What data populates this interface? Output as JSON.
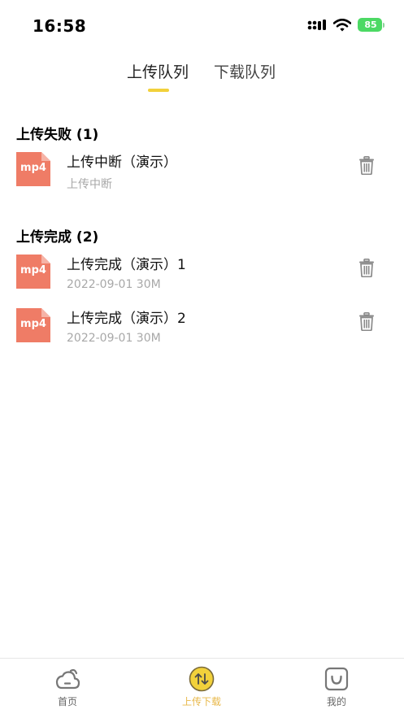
{
  "status_bar": {
    "time": "16:58",
    "battery": "85"
  },
  "tabs": [
    {
      "label": "上传队列",
      "active": true
    },
    {
      "label": "下载队列",
      "active": false
    }
  ],
  "sections": {
    "failed": {
      "title": "上传失败 (1)",
      "items": [
        {
          "ext": "mp4",
          "name": "上传中断（演示）",
          "meta": "上传中断"
        }
      ]
    },
    "done": {
      "title": "上传完成 (2)",
      "items": [
        {
          "ext": "mp4",
          "name": "上传完成（演示）1",
          "meta": "2022-09-01 30M"
        },
        {
          "ext": "mp4",
          "name": "上传完成（演示）2",
          "meta": "2022-09-01 30M"
        }
      ]
    }
  },
  "bottom_nav": [
    {
      "label": "首页",
      "icon": "cloud-icon",
      "active": false
    },
    {
      "label": "上传下载",
      "icon": "transfer-icon",
      "active": true
    },
    {
      "label": "我的",
      "icon": "face-icon",
      "active": false
    }
  ],
  "colors": {
    "accent": "#f2d13b",
    "active_label": "#e8b84a",
    "file_icon": "#ef7c66",
    "battery": "#4cd964"
  }
}
